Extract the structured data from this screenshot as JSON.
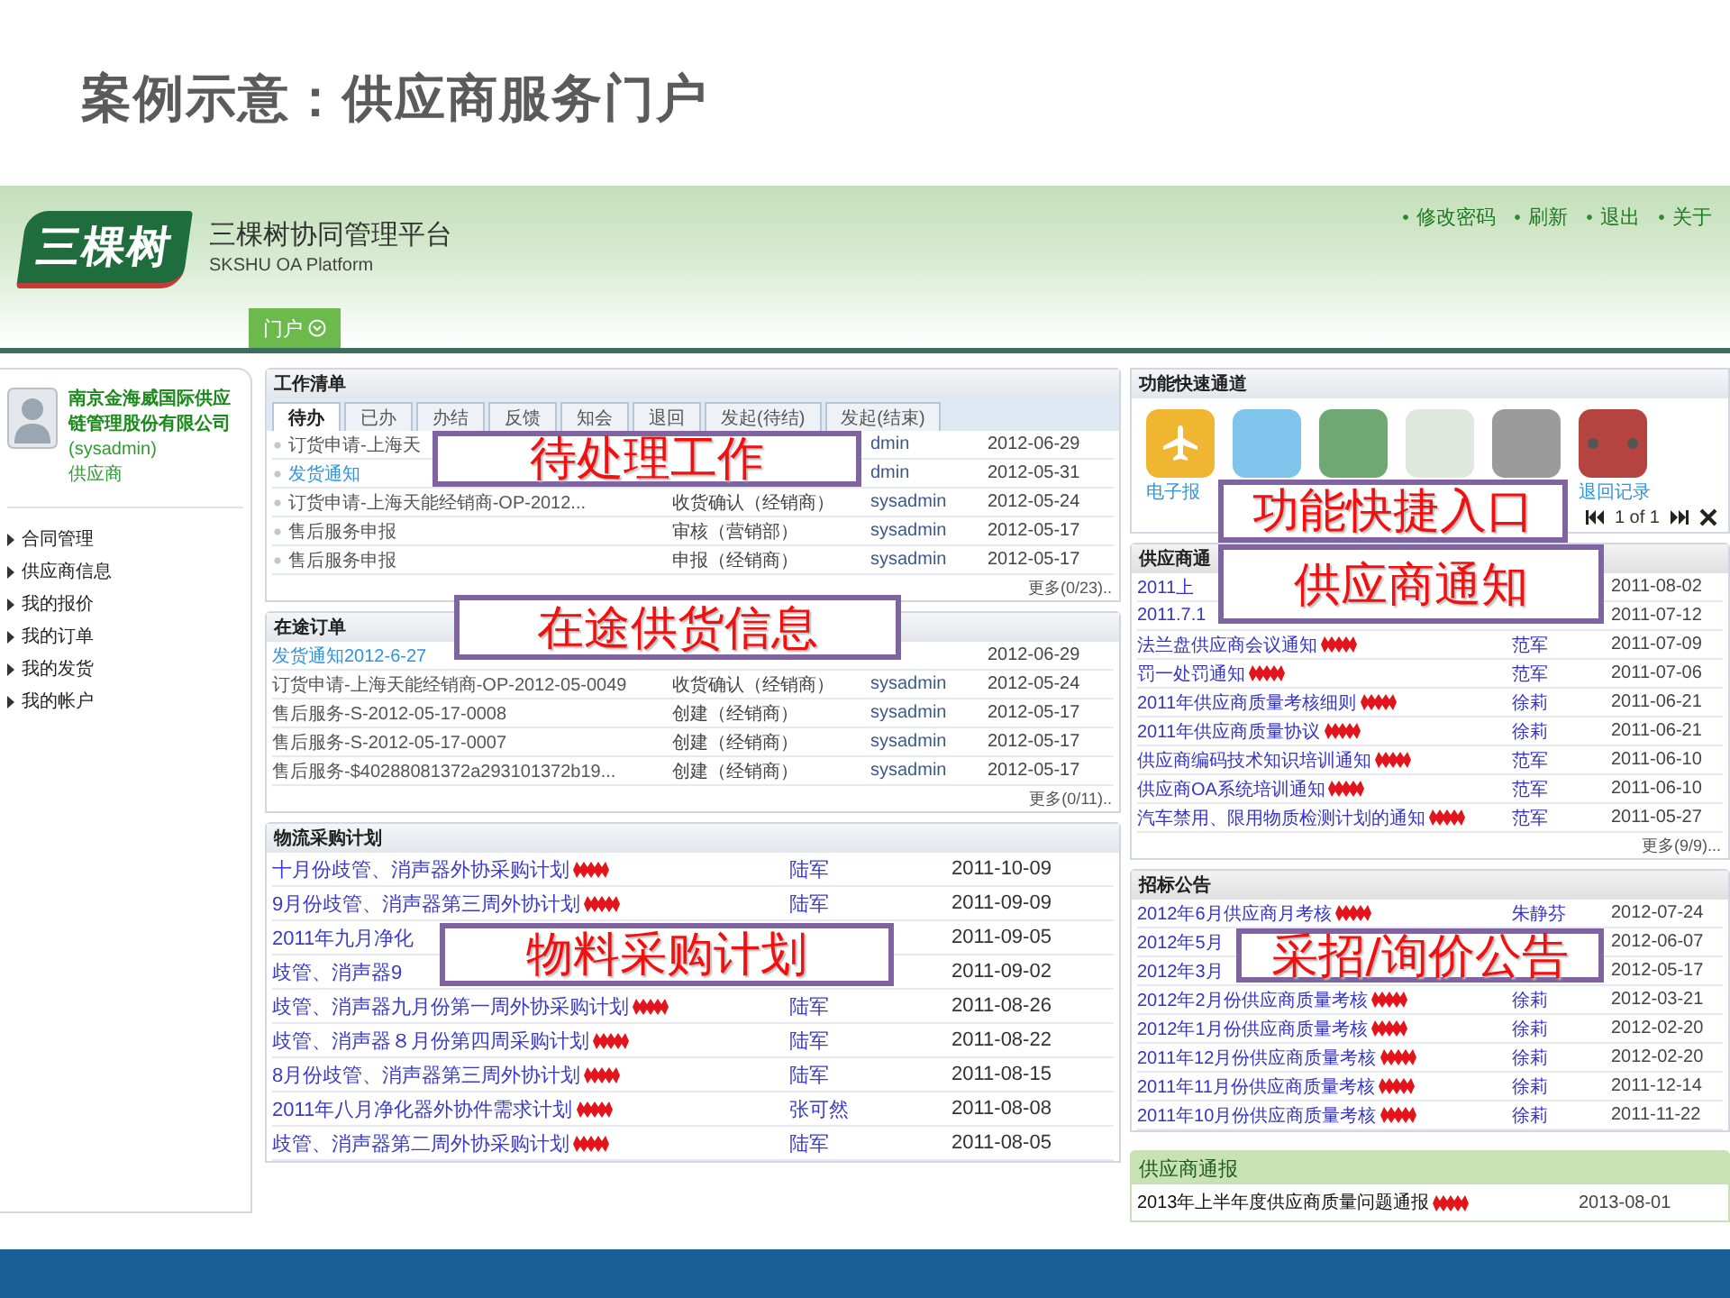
{
  "slide_title": "案例示意：供应商服务门户",
  "app": {
    "logo_text": "三棵树",
    "platform_name": "三棵树协同管理平台",
    "platform_subtitle": "SKSHU OA Platform",
    "top_links": [
      "修改密码",
      "刷新",
      "退出",
      "关于"
    ],
    "nav_tabs": [
      {
        "label": "门户",
        "selected": true
      }
    ],
    "user": {
      "company": "南京金海威国际供应链管理股份有限公司",
      "account": "(sysadmin)",
      "role": "供应商"
    },
    "menu": [
      "合同管理",
      "供应商信息",
      "我的报价",
      "我的订单",
      "我的发货",
      "我的帐户"
    ],
    "work_list": {
      "title": "工作清单",
      "tabs": [
        {
          "label": "待办",
          "selected": true
        },
        {
          "label": "已办",
          "selected": false
        },
        {
          "label": "办结",
          "selected": false
        },
        {
          "label": "反馈",
          "selected": false
        },
        {
          "label": "知会",
          "selected": false
        },
        {
          "label": "退回",
          "selected": false
        },
        {
          "label": "发起(待结)",
          "selected": false
        },
        {
          "label": "发起(结束)",
          "selected": false
        }
      ],
      "rows": [
        {
          "title": "订货申请-上海天",
          "link": false,
          "user": "dmin",
          "date": "2012-06-29"
        },
        {
          "title": "发货通知",
          "link": true,
          "user": "dmin",
          "date": "2012-05-31"
        },
        {
          "title": "订货申请-上海天能经销商-OP-2012...",
          "link": false,
          "step": "收货确认（经销商）",
          "user": "sysadmin",
          "date": "2012-05-24"
        },
        {
          "title": "售后服务申报",
          "link": false,
          "step": "审核（营销部）",
          "user": "sysadmin",
          "date": "2012-05-17"
        },
        {
          "title": "售后服务申报",
          "link": false,
          "step": "申报（经销商）",
          "user": "sysadmin",
          "date": "2012-05-17"
        }
      ],
      "more": "更多(0/23).."
    },
    "orders": {
      "title": "在途订单",
      "rows": [
        {
          "title": "发货通知2012-6-27",
          "link": true,
          "date": "2012-06-29"
        },
        {
          "title": "订货申请-上海天能经销商-OP-2012-05-0049",
          "link": false,
          "step": "收货确认（经销商）",
          "user": "sysadmin",
          "date": "2012-05-24"
        },
        {
          "title": "售后服务-S-2012-05-17-0008",
          "link": false,
          "step": "创建（经销商）",
          "user": "sysadmin",
          "date": "2012-05-17"
        },
        {
          "title": "售后服务-S-2012-05-17-0007",
          "link": false,
          "step": "创建（经销商）",
          "user": "sysadmin",
          "date": "2012-05-17"
        },
        {
          "title": "售后服务-$40288081372a293101372b19...",
          "link": false,
          "step": "创建（经销商）",
          "user": "sysadmin",
          "date": "2012-05-17"
        }
      ],
      "more": "更多(0/11).."
    },
    "purchase_plan": {
      "title": "物流采购计划",
      "rows": [
        {
          "title": "十月份歧管、消声器外协采购计划",
          "link": true,
          "new": true,
          "user": "陆军",
          "date": "2011-10-09"
        },
        {
          "title": "9月份歧管、消声器第三周外协计划",
          "link": true,
          "new": true,
          "user": "陆军",
          "date": "2011-09-09"
        },
        {
          "title": "2011年九月净化",
          "link": true,
          "date": "2011-09-05"
        },
        {
          "title": "歧管、消声器9",
          "link": true,
          "date": "2011-09-02"
        },
        {
          "title": "歧管、消声器九月份第一周外协采购计划",
          "link": true,
          "new": true,
          "user": "陆军",
          "date": "2011-08-26"
        },
        {
          "title": "歧管、消声器８月份第四周采购计划",
          "link": true,
          "new": true,
          "user": "陆军",
          "date": "2011-08-22"
        },
        {
          "title": "8月份歧管、消声器第三周外协计划",
          "link": true,
          "new": true,
          "user": "陆军",
          "date": "2011-08-15"
        },
        {
          "title": "2011年八月净化器外协件需求计划",
          "link": true,
          "new": true,
          "user": "张可然",
          "date": "2011-08-08"
        },
        {
          "title": "歧管、消声器第二周外协采购计划",
          "link": true,
          "new": true,
          "user": "陆军",
          "date": "2011-08-05"
        }
      ]
    },
    "quick_access": {
      "title": "功能快速通道",
      "tiles": [
        {
          "label": "电子报",
          "color": "#f0b631"
        },
        {
          "color": "#7fc4ea"
        },
        {
          "color": "#6fa873"
        },
        {
          "color": "#dfe8df"
        },
        {
          "color": "#9b9b9b"
        },
        {
          "label": "退回记录",
          "color": "#b5433f"
        }
      ],
      "pager": "1 of 1"
    },
    "supplier_notices": {
      "title": "供应商通",
      "rows": [
        {
          "title": "2011上",
          "link": true,
          "date": "2011-08-02"
        },
        {
          "title": "2011.7.1",
          "link": true,
          "date": "2011-07-12"
        },
        {
          "title": "法兰盘供应商会议通知",
          "link": true,
          "new": true,
          "user": "范军",
          "date": "2011-07-09"
        },
        {
          "title": "罚一处罚通知",
          "link": true,
          "new": true,
          "user": "范军",
          "date": "2011-07-06"
        },
        {
          "title": "2011年供应商质量考核细则",
          "link": true,
          "new": true,
          "user": "徐莉",
          "date": "2011-06-21"
        },
        {
          "title": "2011年供应商质量协议",
          "link": true,
          "new": true,
          "user": "徐莉",
          "date": "2011-06-21"
        },
        {
          "title": "供应商编码技术知识培训通知",
          "link": true,
          "new": true,
          "user": "范军",
          "date": "2011-06-10"
        },
        {
          "title": "供应商OA系统培训通知",
          "link": true,
          "new": true,
          "user": "范军",
          "date": "2011-06-10"
        },
        {
          "title": "汽车禁用、限用物质检测计划的通知",
          "link": true,
          "new": true,
          "user": "范军",
          "date": "2011-05-27"
        }
      ],
      "more": "更多(9/9)..."
    },
    "tenders": {
      "title": "招标公告",
      "rows": [
        {
          "title": "2012年6月供应商月考核",
          "link": true,
          "new": true,
          "user": "朱静芬",
          "date": "2012-07-24"
        },
        {
          "title": "2012年5月",
          "link": true,
          "date": "2012-06-07"
        },
        {
          "title": "2012年3月",
          "link": true,
          "date": "2012-05-17"
        },
        {
          "title": "2012年2月份供应商质量考核",
          "link": true,
          "new": true,
          "user": "徐莉",
          "date": "2012-03-21"
        },
        {
          "title": "2012年1月份供应商质量考核",
          "link": true,
          "new": true,
          "user": "徐莉",
          "date": "2012-02-20"
        },
        {
          "title": "2011年12月份供应商质量考核",
          "link": true,
          "new": true,
          "user": "徐莉",
          "date": "2012-02-20"
        },
        {
          "title": "2011年11月份供应商质量考核",
          "link": true,
          "new": true,
          "user": "徐莉",
          "date": "2011-12-14"
        },
        {
          "title": "2011年10月份供应商质量考核",
          "link": true,
          "new": true,
          "user": "徐莉",
          "date": "2011-11-22"
        }
      ]
    },
    "supplier_report": {
      "title": "供应商通报",
      "rows": [
        {
          "title": "2013年上半年度供应商质量问题通报",
          "new": true,
          "date": "2013-08-01"
        }
      ]
    }
  },
  "callouts": [
    {
      "text": "待处理工作"
    },
    {
      "text": "在途供货信息"
    },
    {
      "text": "物料采购计划"
    },
    {
      "text": "功能快捷入口"
    },
    {
      "text": "供应商通知"
    },
    {
      "text": "采招/询价公告"
    }
  ]
}
